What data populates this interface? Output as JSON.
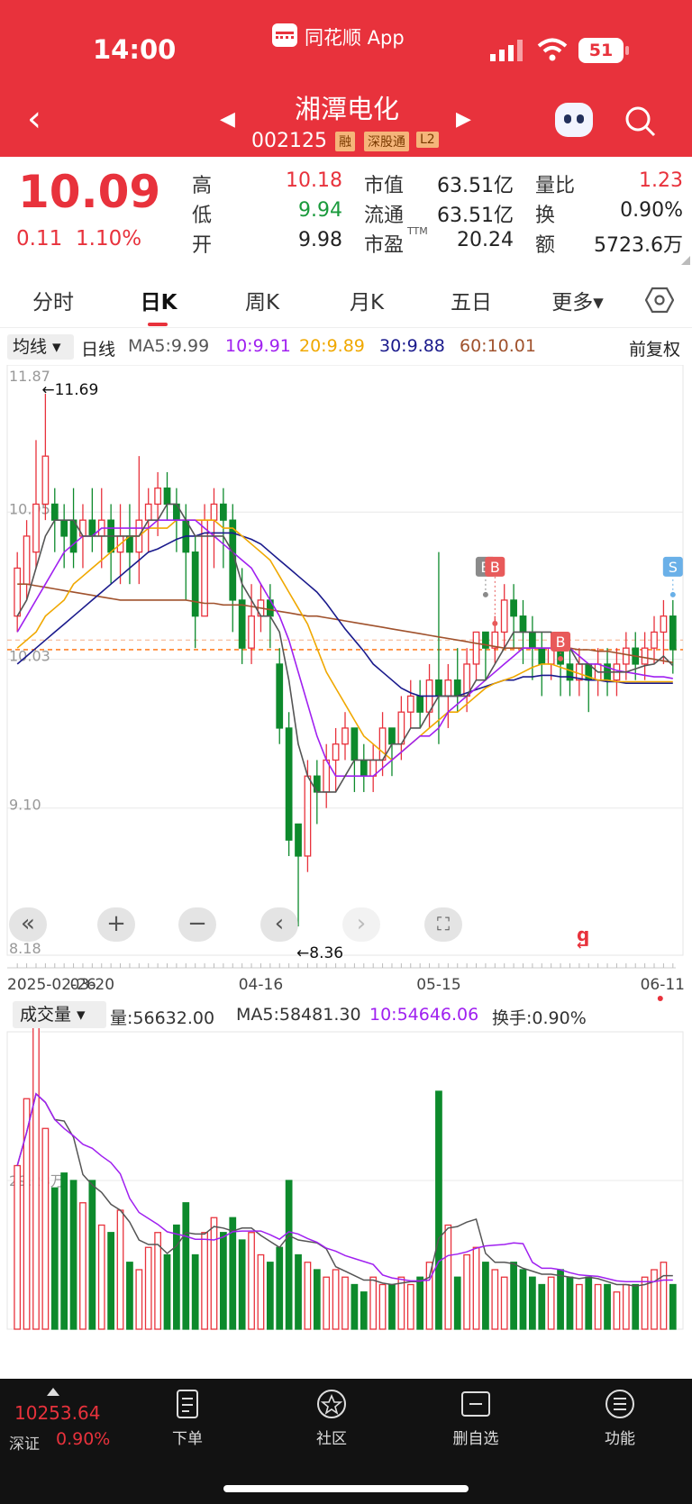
{
  "status": {
    "time": "14:00",
    "app_label": "同花顺 App",
    "battery": "51"
  },
  "header": {
    "name": "湘潭电化",
    "code": "002125",
    "badges": [
      "融",
      "深股通",
      "L2"
    ]
  },
  "quote": {
    "price": "10.09",
    "change": "0.11",
    "change_pct": "1.10%",
    "col1": [
      {
        "label": "高",
        "value": "10.18",
        "color": "#e8323c"
      },
      {
        "label": "低",
        "value": "9.94",
        "color": "#1a9a3c"
      },
      {
        "label": "开",
        "value": "9.98",
        "color": "#222"
      }
    ],
    "col2": [
      {
        "label": "市值",
        "value": "63.51亿"
      },
      {
        "label": "流通",
        "value": "63.51亿"
      },
      {
        "label": "市盈",
        "sup": "TTM",
        "value": "20.24"
      }
    ],
    "col3": [
      {
        "label": "量比",
        "value": "1.23",
        "color": "#e8323c"
      },
      {
        "label": "换",
        "value": "0.90%",
        "color": "#222"
      },
      {
        "label": "额",
        "value": "5723.6万",
        "color": "#222"
      }
    ]
  },
  "tabs": [
    "分时",
    "日K",
    "周K",
    "月K",
    "五日",
    "更多▾"
  ],
  "active_tab": 1,
  "ma_bar": {
    "selector": "均线 ▾",
    "period": "日线",
    "ma5": "MA5:9.99",
    "ma10": "10:9.91",
    "ma20": "20:9.89",
    "ma30": "30:9.88",
    "ma60": "60:10.01",
    "adjust": "前复权"
  },
  "colors": {
    "up": "#e8323c",
    "down": "#0d8a2c",
    "ma5": "#555555",
    "ma10": "#a020f0",
    "ma20": "#f0a800",
    "ma30": "#1a1a8c",
    "ma60": "#a0522d",
    "accent": "#ff6a00"
  },
  "price_axis": {
    "top": "11.87",
    "mid1": "10.95",
    "mid2": "10.03",
    "mid3": "9.10",
    "bottom": "8.18"
  },
  "annotations": {
    "high": "←11.69",
    "low": "←8.36"
  },
  "signals": {
    "b1": "B",
    "b2": "B",
    "b3": "B",
    "s1": "S"
  },
  "dates": [
    "2025-02-26",
    "03-20",
    "04-16",
    "05-15",
    "06-11"
  ],
  "volume_bar": {
    "selector": "成交量 ▾",
    "vol": "量:56632.00",
    "ma5": "MA5:58481.30",
    "ma10": "10:54646.06",
    "turnover": "换手:0.90%"
  },
  "volume_axis": {
    "mid": "29.23万"
  },
  "bottom": {
    "index_value": "10253.64",
    "index_name": "深证",
    "index_change": "0.90%",
    "buttons": [
      "下单",
      "社区",
      "删自选",
      "功能"
    ]
  },
  "chart_data": {
    "type": "candlestick",
    "ylim": [
      8.18,
      11.87
    ],
    "candles": [
      [
        10.3,
        10.6,
        10.2,
        10.7
      ],
      [
        10.5,
        10.8,
        10.4,
        10.9
      ],
      [
        10.7,
        11.0,
        10.6,
        11.4
      ],
      [
        11.0,
        11.3,
        10.9,
        11.69
      ],
      [
        11.0,
        10.9,
        10.7,
        11.1
      ],
      [
        10.9,
        10.8,
        10.6,
        11.0
      ],
      [
        10.9,
        10.7,
        10.6,
        11.1
      ],
      [
        10.8,
        10.9,
        10.6,
        11.0
      ],
      [
        10.9,
        10.8,
        10.7,
        11.1
      ],
      [
        10.8,
        10.9,
        10.6,
        11.1
      ],
      [
        10.9,
        10.7,
        10.5,
        11.0
      ],
      [
        10.7,
        10.8,
        10.5,
        11.0
      ],
      [
        10.8,
        10.7,
        10.5,
        11.0
      ],
      [
        10.7,
        10.9,
        10.5,
        11.3
      ],
      [
        10.9,
        11.0,
        10.7,
        11.1
      ],
      [
        11.0,
        11.1,
        10.8,
        11.2
      ],
      [
        11.1,
        11.0,
        10.9,
        11.2
      ],
      [
        11.0,
        10.9,
        10.7,
        11.1
      ],
      [
        10.9,
        10.7,
        10.4,
        11.0
      ],
      [
        10.7,
        10.3,
        10.1,
        10.8
      ],
      [
        10.3,
        10.9,
        10.3,
        11.0
      ],
      [
        10.9,
        11.0,
        10.6,
        11.1
      ],
      [
        11.0,
        10.9,
        10.6,
        11.1
      ],
      [
        10.9,
        10.4,
        10.2,
        11.0
      ],
      [
        10.4,
        10.1,
        10.0,
        10.6
      ],
      [
        10.1,
        10.3,
        10.0,
        10.5
      ],
      [
        10.3,
        10.4,
        10.2,
        10.5
      ],
      [
        10.4,
        10.3,
        10.1,
        10.5
      ],
      [
        10.0,
        9.6,
        9.5,
        10.1
      ],
      [
        9.6,
        8.9,
        8.8,
        9.7
      ],
      [
        9.0,
        8.8,
        8.36,
        9.0
      ],
      [
        8.8,
        9.3,
        8.7,
        9.4
      ],
      [
        9.3,
        9.2,
        9.0,
        9.4
      ],
      [
        9.2,
        9.4,
        9.1,
        9.5
      ],
      [
        9.4,
        9.5,
        9.2,
        9.6
      ],
      [
        9.5,
        9.6,
        9.4,
        9.7
      ],
      [
        9.6,
        9.4,
        9.2,
        9.6
      ],
      [
        9.4,
        9.3,
        9.2,
        9.5
      ],
      [
        9.3,
        9.4,
        9.2,
        9.5
      ],
      [
        9.4,
        9.6,
        9.3,
        9.7
      ],
      [
        9.6,
        9.5,
        9.3,
        9.6
      ],
      [
        9.5,
        9.7,
        9.4,
        9.8
      ],
      [
        9.7,
        9.8,
        9.6,
        9.9
      ],
      [
        9.8,
        9.7,
        9.6,
        9.9
      ],
      [
        9.7,
        9.9,
        9.6,
        10.0
      ],
      [
        9.9,
        9.8,
        9.5,
        10.7
      ],
      [
        9.8,
        9.9,
        9.6,
        10.0
      ],
      [
        9.9,
        9.8,
        9.7,
        10.1
      ],
      [
        9.8,
        10.0,
        9.7,
        10.1
      ],
      [
        10.0,
        10.2,
        9.9,
        10.2
      ],
      [
        10.2,
        10.1,
        9.9,
        10.2
      ],
      [
        10.1,
        10.2,
        10.0,
        10.3
      ],
      [
        10.2,
        10.4,
        10.1,
        10.5
      ],
      [
        10.4,
        10.3,
        10.1,
        10.5
      ],
      [
        10.3,
        10.2,
        10.0,
        10.4
      ],
      [
        10.2,
        10.1,
        9.9,
        10.3
      ],
      [
        10.1,
        10.0,
        9.8,
        10.2
      ],
      [
        10.0,
        10.1,
        9.9,
        10.2
      ],
      [
        10.1,
        10.0,
        9.8,
        10.2
      ],
      [
        10.0,
        9.9,
        9.8,
        10.1
      ],
      [
        9.9,
        10.0,
        9.8,
        10.1
      ],
      [
        10.0,
        9.9,
        9.7,
        10.0
      ],
      [
        9.9,
        10.0,
        9.8,
        10.1
      ],
      [
        10.0,
        9.9,
        9.8,
        10.1
      ],
      [
        9.9,
        10.0,
        9.8,
        10.1
      ],
      [
        10.0,
        10.1,
        9.9,
        10.2
      ],
      [
        10.1,
        10.0,
        9.9,
        10.2
      ],
      [
        10.0,
        10.1,
        9.9,
        10.2
      ],
      [
        10.1,
        10.2,
        10.0,
        10.3
      ],
      [
        10.2,
        10.3,
        10.0,
        10.4
      ],
      [
        10.3,
        10.09,
        9.94,
        10.4
      ]
    ],
    "ma5": [
      10.3,
      10.4,
      10.6,
      10.8,
      10.9,
      10.9,
      10.9,
      10.8,
      10.8,
      10.8,
      10.8,
      10.8,
      10.8,
      10.8,
      10.9,
      10.9,
      11.0,
      11.0,
      10.9,
      10.8,
      10.8,
      10.8,
      10.8,
      10.7,
      10.5,
      10.4,
      10.3,
      10.3,
      10.2,
      9.9,
      9.5,
      9.3,
      9.2,
      9.2,
      9.2,
      9.3,
      9.4,
      9.4,
      9.4,
      9.4,
      9.5,
      9.5,
      9.6,
      9.6,
      9.7,
      9.8,
      9.8,
      9.8,
      9.8,
      9.9,
      9.9,
      10.0,
      10.1,
      10.2,
      10.2,
      10.2,
      10.2,
      10.2,
      10.1,
      10.1,
      10.0,
      10.0,
      9.95,
      9.95,
      9.95,
      9.95,
      9.97,
      9.99,
      10.0,
      10.05,
      9.99
    ],
    "ma10": [
      10.2,
      10.3,
      10.4,
      10.5,
      10.6,
      10.7,
      10.75,
      10.8,
      10.8,
      10.85,
      10.85,
      10.85,
      10.85,
      10.85,
      10.85,
      10.9,
      10.9,
      10.9,
      10.9,
      10.9,
      10.85,
      10.8,
      10.75,
      10.7,
      10.65,
      10.6,
      10.5,
      10.4,
      10.3,
      10.15,
      9.95,
      9.75,
      9.55,
      9.4,
      9.3,
      9.3,
      9.3,
      9.3,
      9.3,
      9.35,
      9.4,
      9.45,
      9.5,
      9.55,
      9.55,
      9.6,
      9.7,
      9.75,
      9.8,
      9.85,
      9.9,
      9.95,
      10.0,
      10.05,
      10.1,
      10.1,
      10.1,
      10.1,
      10.1,
      10.1,
      10.05,
      10.0,
      10.0,
      9.98,
      9.96,
      9.95,
      9.94,
      9.93,
      9.92,
      9.92,
      9.91
    ],
    "ma20": [
      10.1,
      10.15,
      10.2,
      10.3,
      10.35,
      10.4,
      10.5,
      10.55,
      10.6,
      10.65,
      10.7,
      10.75,
      10.8,
      10.8,
      10.85,
      10.85,
      10.85,
      10.9,
      10.9,
      10.9,
      10.9,
      10.9,
      10.85,
      10.85,
      10.8,
      10.75,
      10.7,
      10.65,
      10.55,
      10.45,
      10.35,
      10.25,
      10.1,
      9.95,
      9.85,
      9.75,
      9.65,
      9.55,
      9.5,
      9.45,
      9.4,
      9.45,
      9.5,
      9.55,
      9.6,
      9.65,
      9.7,
      9.7,
      9.75,
      9.8,
      9.85,
      9.88,
      9.9,
      9.92,
      9.95,
      9.98,
      10.0,
      10.0,
      9.98,
      9.96,
      9.94,
      9.92,
      9.9,
      9.9,
      9.89,
      9.89,
      9.89,
      9.89,
      9.89,
      9.89,
      9.89
    ],
    "ma30": [
      10.0,
      10.05,
      10.1,
      10.15,
      10.2,
      10.25,
      10.3,
      10.35,
      10.4,
      10.45,
      10.5,
      10.55,
      10.6,
      10.65,
      10.7,
      10.72,
      10.75,
      10.78,
      10.8,
      10.8,
      10.82,
      10.82,
      10.82,
      10.82,
      10.8,
      10.78,
      10.75,
      10.7,
      10.65,
      10.6,
      10.55,
      10.5,
      10.45,
      10.38,
      10.3,
      10.22,
      10.15,
      10.08,
      10.0,
      9.95,
      9.9,
      9.85,
      9.82,
      9.8,
      9.8,
      9.8,
      9.8,
      9.8,
      9.82,
      9.84,
      9.86,
      9.88,
      9.9,
      9.9,
      9.92,
      9.92,
      9.93,
      9.93,
      9.92,
      9.92,
      9.91,
      9.9,
      9.9,
      9.89,
      9.89,
      9.88,
      9.88,
      9.88,
      9.88,
      9.88,
      9.88
    ],
    "ma60": [
      10.5,
      10.5,
      10.49,
      10.48,
      10.47,
      10.46,
      10.45,
      10.44,
      10.43,
      10.42,
      10.41,
      10.4,
      10.4,
      10.4,
      10.4,
      10.4,
      10.4,
      10.4,
      10.4,
      10.39,
      10.38,
      10.38,
      10.37,
      10.37,
      10.37,
      10.36,
      10.35,
      10.34,
      10.33,
      10.32,
      10.31,
      10.3,
      10.3,
      10.29,
      10.28,
      10.27,
      10.26,
      10.25,
      10.24,
      10.23,
      10.22,
      10.21,
      10.2,
      10.19,
      10.18,
      10.17,
      10.16,
      10.15,
      10.14,
      10.13,
      10.12,
      10.11,
      10.1,
      10.1,
      10.1,
      10.1,
      10.1,
      10.1,
      10.1,
      10.1,
      10.09,
      10.09,
      10.08,
      10.08,
      10.07,
      10.06,
      10.05,
      10.04,
      10.03,
      10.02,
      10.01
    ],
    "volumes": [
      22,
      31,
      42,
      27,
      19,
      21,
      20,
      17,
      20,
      14,
      13,
      16,
      9,
      8,
      11,
      13,
      10,
      14,
      17,
      10,
      13,
      15,
      13,
      15,
      12,
      13,
      10,
      9,
      11,
      20,
      10,
      9,
      8,
      7,
      8,
      7,
      6,
      5,
      7,
      6,
      6,
      7,
      6,
      7,
      9,
      32,
      14,
      7,
      10,
      11,
      9,
      8,
      7,
      9,
      8,
      7,
      6,
      7,
      8,
      7,
      6,
      7,
      6,
      6,
      5,
      6,
      6,
      7,
      8,
      9,
      6
    ],
    "vol_ylim": [
      0,
      40
    ]
  }
}
